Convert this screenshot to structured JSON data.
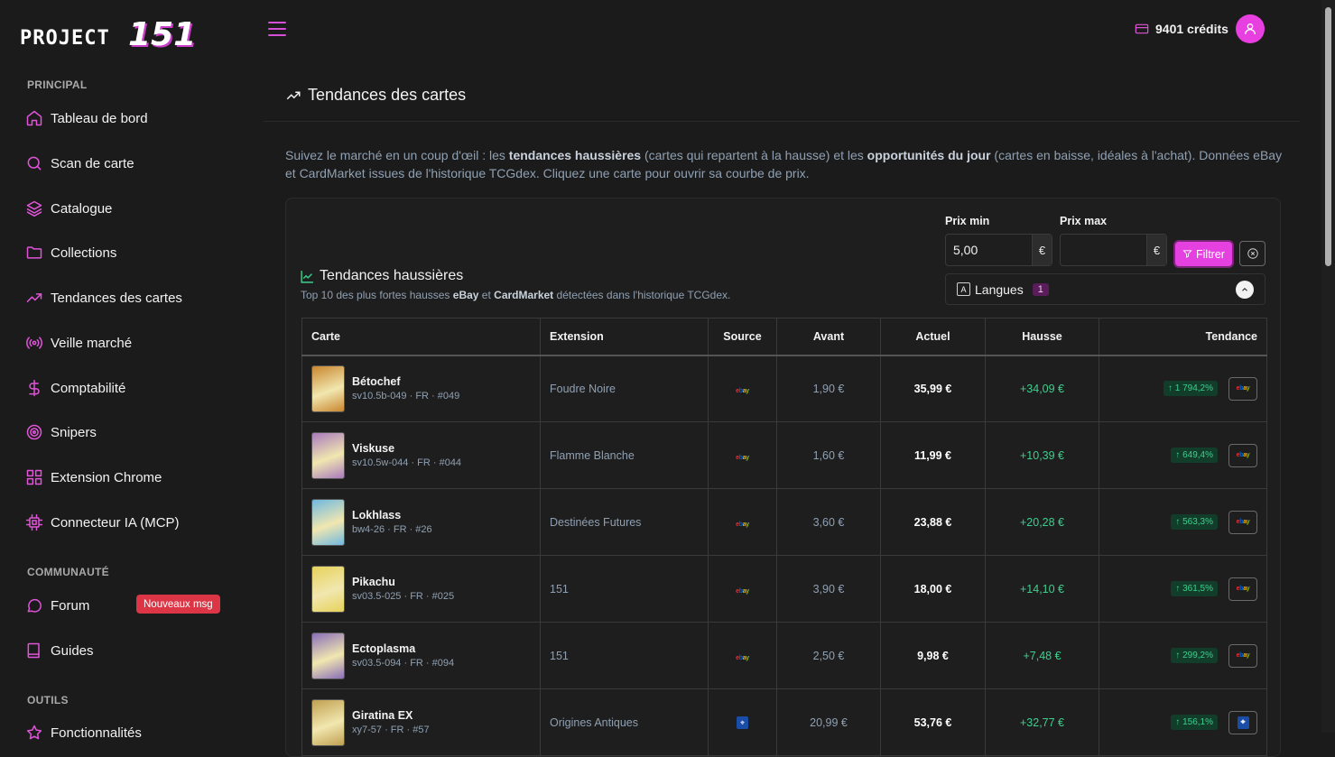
{
  "brand": {
    "logo_text": "PROJECT",
    "logo_num": "151"
  },
  "header": {
    "credits": "9401 crédits"
  },
  "sidebar": {
    "sections": [
      {
        "label": "PRINCIPAL"
      },
      {
        "label": "COMMUNAUTÉ"
      },
      {
        "label": "OUTILS"
      }
    ],
    "items": [
      {
        "label": "Tableau de bord",
        "icon": "home-icon"
      },
      {
        "label": "Scan de carte",
        "icon": "search-icon"
      },
      {
        "label": "Catalogue",
        "icon": "layers-icon"
      },
      {
        "label": "Collections",
        "icon": "folder-icon"
      },
      {
        "label": "Tendances des cartes",
        "icon": "trending-up-icon"
      },
      {
        "label": "Veille marché",
        "icon": "broadcast-icon"
      },
      {
        "label": "Comptabilité",
        "icon": "dollar-icon"
      },
      {
        "label": "Snipers",
        "icon": "target-icon"
      },
      {
        "label": "Extension Chrome",
        "icon": "grid-icon"
      },
      {
        "label": "Connecteur IA (MCP)",
        "icon": "chip-icon"
      },
      {
        "label": "Forum",
        "icon": "chat-icon"
      },
      {
        "label": "Guides",
        "icon": "book-icon"
      },
      {
        "label": "Fonctionnalités",
        "icon": "star-icon"
      }
    ],
    "forum_badge": "Nouveaux msg"
  },
  "page": {
    "title": "Tendances des cartes",
    "intro_1": "Suivez le marché en un coup d'œil : les ",
    "intro_b1": "tendances haussières",
    "intro_2": " (cartes qui repartent à la hausse) et les ",
    "intro_b2": "opportunités du jour",
    "intro_3": " (cartes en baisse, idéales à l'achat). Données eBay et CardMarket issues de l'historique TCGdex. Cliquez une carte pour ouvrir sa courbe de prix."
  },
  "filters": {
    "min_label": "Prix min",
    "min_value": "5,00",
    "max_label": "Prix max",
    "max_value": "",
    "currency": "€",
    "filter_button": "Filtrer",
    "languages_label": "Langues",
    "languages_count": "1"
  },
  "section": {
    "title": "Tendances haussières",
    "sub_1": "Top 10 des plus fortes hausses ",
    "sub_b1": "eBay",
    "sub_2": " et ",
    "sub_b2": "CardMarket",
    "sub_3": " détectées dans l'historique TCGdex."
  },
  "table": {
    "headers": [
      "Carte",
      "Extension",
      "Source",
      "Avant",
      "Actuel",
      "Hausse",
      "Tendance"
    ],
    "rows": [
      {
        "name": "Bétochef",
        "meta": "sv10.5b-049 · FR · #049",
        "extension": "Foudre Noire",
        "source": "ebay",
        "avant": "1,90 €",
        "actuel": "35,99 €",
        "hausse": "+34,09 €",
        "pct": "↑ 1 794,2%",
        "thumb": "#c9862e"
      },
      {
        "name": "Viskuse",
        "meta": "sv10.5w-044 · FR · #044",
        "extension": "Flamme Blanche",
        "source": "ebay",
        "avant": "1,60 €",
        "actuel": "11,99 €",
        "hausse": "+10,39 €",
        "pct": "↑ 649,4%",
        "thumb": "#a97bbd"
      },
      {
        "name": "Lokhlass",
        "meta": "bw4-26 · FR · #26",
        "extension": "Destinées Futures",
        "source": "ebay",
        "avant": "3,60 €",
        "actuel": "23,88 €",
        "hausse": "+20,28 €",
        "pct": "↑ 563,3%",
        "thumb": "#6fb8e0"
      },
      {
        "name": "Pikachu",
        "meta": "sv03.5-025 · FR · #025",
        "extension": "151",
        "source": "ebay",
        "avant": "3,90 €",
        "actuel": "18,00 €",
        "hausse": "+14,10 €",
        "pct": "↑ 361,5%",
        "thumb": "#e6d25a"
      },
      {
        "name": "Ectoplasma",
        "meta": "sv03.5-094 · FR · #094",
        "extension": "151",
        "source": "ebay",
        "avant": "2,50 €",
        "actuel": "9,98 €",
        "hausse": "+7,48 €",
        "pct": "↑ 299,2%",
        "thumb": "#8a6fb8"
      },
      {
        "name": "Giratina EX",
        "meta": "xy7-57 · FR · #57",
        "extension": "Origines Antiques",
        "source": "cardmarket",
        "avant": "20,99 €",
        "actuel": "53,76 €",
        "hausse": "+32,77 €",
        "pct": "↑ 156,1%",
        "thumb": "#c0a050"
      }
    ]
  },
  "colors": {
    "accent": "#e540e0",
    "positive": "#3ecf8e",
    "background": "#1b1b1b"
  }
}
